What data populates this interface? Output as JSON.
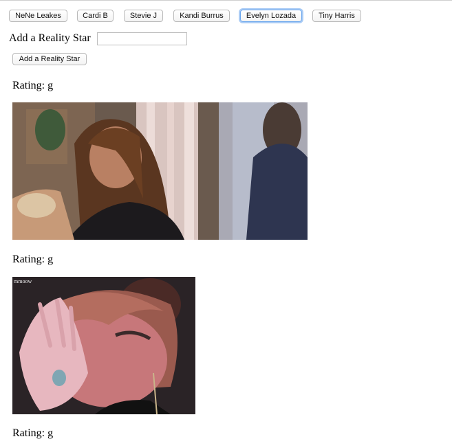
{
  "star_buttons": [
    {
      "label": "NeNe Leakes"
    },
    {
      "label": "Cardi B"
    },
    {
      "label": "Stevie J"
    },
    {
      "label": "Kandi Burrus"
    },
    {
      "label": "Evelyn Lozada",
      "focused": true
    },
    {
      "label": "Tiny Harris"
    }
  ],
  "add_form": {
    "label": "Add a Reality Star",
    "input_value": "",
    "submit_label": "Add a Reality Star"
  },
  "results": [
    {
      "rating_text": "Rating: g",
      "image_caption": "",
      "image_watermark": ""
    },
    {
      "rating_text": "Rating: g",
      "image_caption": "",
      "image_watermark": "mmoow"
    },
    {
      "rating_text": "Rating: g"
    }
  ]
}
